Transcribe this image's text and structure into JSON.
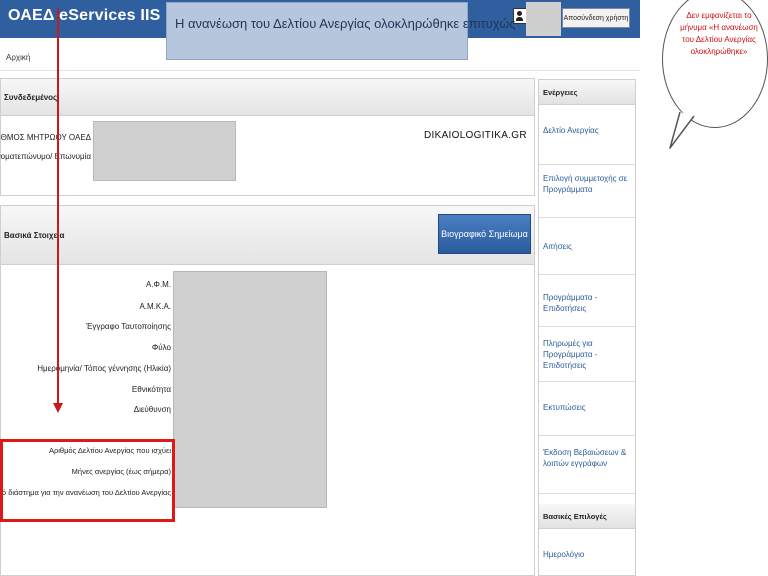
{
  "header": {
    "app_title": "ΟΑΕΔ eServices IIS",
    "toast_message": "Η ανανέωση του Δελτίου Ανεργίας ολοκληρώθηκε επιτυχώς",
    "logout_label": "Αποσύνδεση χρήστη"
  },
  "breadcrumb": "Αρχική",
  "panel_connected": {
    "title": "Συνδεδεμένος",
    "label_registry": "ΑΡΙΘΜΟΣ ΜΗΤΡΩΟΥ ΟΑΕΔ",
    "label_name": "Ονοματεπώνυμο/ Επωνυμία"
  },
  "watermark": "DIKAIOLOGITIKA.GR",
  "panel_basic": {
    "title": "Βασικά Στοιχεία",
    "bio_button": "Βιογραφικό Σημείωμα",
    "fields": [
      "Α.Φ.Μ.",
      "Α.Μ.Κ.Α.",
      "Έγγραφο Ταυτοποίησης",
      "Φύλο",
      "Ημερομηνία/ Τόπος γέννησης (Ηλικία)",
      "Εθνικότητα",
      "Διεύθυνση"
    ],
    "highlight_fields": [
      "Αριθμός Δελτίου Ανεργίας που ισχύει",
      "Μήνες ανεργίας (έως σήμερα)",
      "Χρονικό διάστημα για την ανανέωση του Δελτίου Ανεργίας"
    ]
  },
  "sidebar": {
    "actions_title": "Ενέργειες",
    "items": [
      "Δελτίο Ανεργίας",
      "Επιλογή συμμετοχής σε Προγράμματα",
      "Αιτήσεις",
      "Προγράμματα - Επιδοτήσεις",
      "Πληρωμές για Προγράμματα - Επιδοτήσεις",
      "Εκτυπώσεις",
      "Έκδοση Βεβαιώσεων & λοιπών εγγράφων"
    ],
    "options_title": "Βασικές Επιλογές",
    "options_items": [
      "Ημερολόγιο"
    ]
  },
  "bubble": {
    "text": "Δεν εμφανίζεται το μήνυμα «Η ανανέωση του Δελτίου Ανεργίας ολοκληρώθηκε»"
  },
  "colors": {
    "header_bg": "#2f5f9e",
    "button_blue": "#3a6cb0",
    "highlight_red": "#e01818",
    "bubble_text": "#d01010",
    "sidebar_link": "#2b5c9c"
  }
}
